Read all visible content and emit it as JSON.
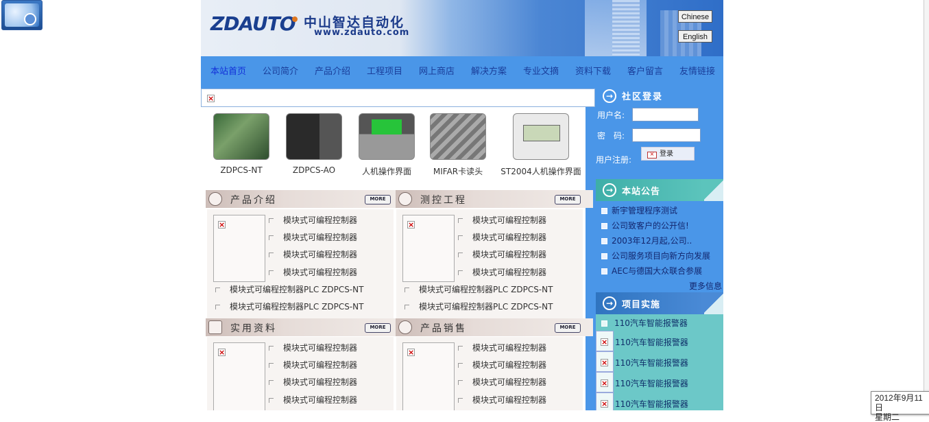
{
  "clock": {
    "date": "2012年9月11日",
    "weekday": "星期二"
  },
  "header": {
    "logo": "ZDAUTO",
    "company_name": "中山智达自动化",
    "website": "www.zdauto.com",
    "lang_chinese": "Chinese",
    "lang_english": "English"
  },
  "nav": {
    "items": [
      "本站首页",
      "公司简介",
      "产品介绍",
      "工程项目",
      "网上商店",
      "解决方案",
      "专业文摘",
      "资料下载",
      "客户留言",
      "友情链接"
    ]
  },
  "products": [
    {
      "caption": "ZDPCS-NT"
    },
    {
      "caption": "ZDPCS-AO"
    },
    {
      "caption": "人机操作界面"
    },
    {
      "caption": "MIFAR卡读头"
    },
    {
      "caption": "ST2004人机操作界面"
    }
  ],
  "sections": [
    {
      "title": "产品介绍",
      "more": "MORE"
    },
    {
      "title": "测控工程",
      "more": "MORE"
    },
    {
      "title": "实用资料",
      "more": "MORE"
    },
    {
      "title": "产品销售",
      "more": "MORE"
    }
  ],
  "list": {
    "short_item": "模块式可编程控制器",
    "long_item": "模块式可编程控制器PLC ZDPCS-NT"
  },
  "login": {
    "title": "社区登录",
    "username_label": "用户名:",
    "password_label": "密　码:",
    "register_label": "用户注册:",
    "login_button": "登录"
  },
  "announcements": {
    "title": "本站公告",
    "items": [
      "新宇管理程序测试",
      "公司致客户的公开信!",
      "2003年12月起,公司..",
      "公司服务项目向新方向发展",
      "AEC与德国大众联合参展"
    ],
    "more": "更多信息"
  },
  "projects": {
    "title": "项目实施",
    "items": [
      "110汽车智能报警器",
      "110汽车智能报警器",
      "110汽车智能报警器",
      "110汽车智能报警器",
      "110汽车智能报警器"
    ]
  },
  "colors": {
    "page_blue": "#4a96e8",
    "nav_text": "#1a3e9a",
    "project_teal": "#6cc8c8"
  }
}
